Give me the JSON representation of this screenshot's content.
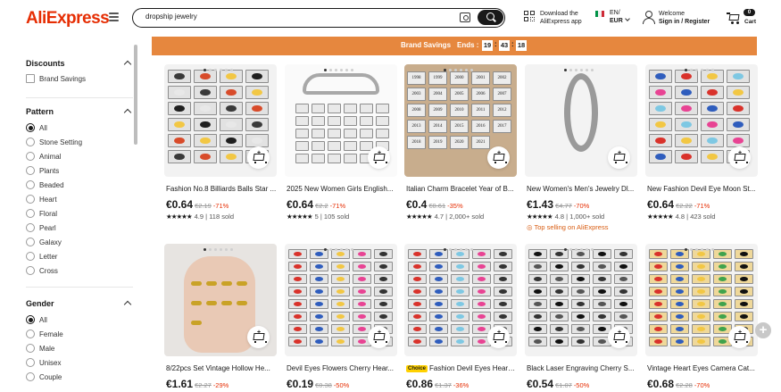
{
  "header": {
    "logo": "AliExpress",
    "search_value": "dropship jewelry",
    "download_line1": "Download the",
    "download_line2": "AliExpress app",
    "lang_line1": "EN/",
    "lang_line2": "EUR",
    "welcome": "Welcome",
    "signin": "Sign in / Register",
    "cart_count": "0",
    "cart_label": "Cart"
  },
  "sidebar": {
    "discounts_title": "Discounts",
    "discounts": [
      "Brand Savings"
    ],
    "pattern_title": "Pattern",
    "patterns": [
      "All",
      "Stone Setting",
      "Animal",
      "Plants",
      "Beaded",
      "Heart",
      "Floral",
      "Pearl",
      "Galaxy",
      "Letter",
      "Cross"
    ],
    "gender_title": "Gender",
    "genders": [
      "All",
      "Female",
      "Male",
      "Unisex",
      "Couple"
    ]
  },
  "banner": {
    "label": "Brand Savings",
    "ends": "Ends :",
    "h": "19",
    "m": "43",
    "s": "18"
  },
  "products": [
    {
      "title": "Fashion No.8 Billiards Balls Star ...",
      "price": "€0.64",
      "orig": "€2.19",
      "disc": "-71%",
      "rating": "4.9",
      "sold": "118 sold"
    },
    {
      "title": "2025 New Women Girls English...",
      "price": "€0.64",
      "orig": "€2.2",
      "disc": "-71%",
      "rating": "5",
      "sold": "105 sold"
    },
    {
      "title": "Italian Charm Bracelet Year of B...",
      "price": "€0.4",
      "orig": "€0.61",
      "disc": "-35%",
      "rating": "4.7",
      "sold": "2,000+ sold"
    },
    {
      "title": "New Women's Men's Jewelry Dl...",
      "price": "€1.43",
      "orig": "€4.77",
      "disc": "-70%",
      "rating": "4.8",
      "sold": "1,000+ sold",
      "badge": "Top selling on AliExpress"
    },
    {
      "title": "New Fashion Devil Eye Moon St...",
      "price": "€0.64",
      "orig": "€2.22",
      "disc": "-71%",
      "rating": "4.8",
      "sold": "423 sold"
    },
    {
      "title": "8/22pcs Set Vintage Hollow He...",
      "price": "€1.61",
      "orig": "€2.27",
      "disc": "-29%"
    },
    {
      "title": "Devil Eyes Flowers Cherry Hear...",
      "price": "€0.19",
      "orig": "€0.38",
      "disc": "-50%"
    },
    {
      "title": "Fashion Devil Eyes Heart ...",
      "choice": "Choice",
      "price": "€0.86",
      "orig": "€1.37",
      "disc": "-36%"
    },
    {
      "title": "Black Laser Engraving Cherry S...",
      "price": "€0.54",
      "orig": "€1.07",
      "disc": "-50%"
    },
    {
      "title": "Vintage Heart Eyes Camera Cat...",
      "price": "€0.68",
      "orig": "€2.28",
      "disc": "-70%"
    }
  ],
  "charm_years": [
    "1998",
    "1999",
    "2000",
    "2001",
    "2002",
    "2003",
    "2004",
    "2005",
    "2006",
    "2007",
    "2008",
    "2009",
    "2010",
    "2011",
    "2012",
    "2013",
    "2014",
    "2015",
    "2016",
    "2017",
    "2018",
    "2019",
    "2020",
    "2021"
  ],
  "colors": {
    "brand": "#e62e04",
    "banner": "#e6873e",
    "discount": "#e62e04",
    "top_selling": "#d85c11"
  }
}
